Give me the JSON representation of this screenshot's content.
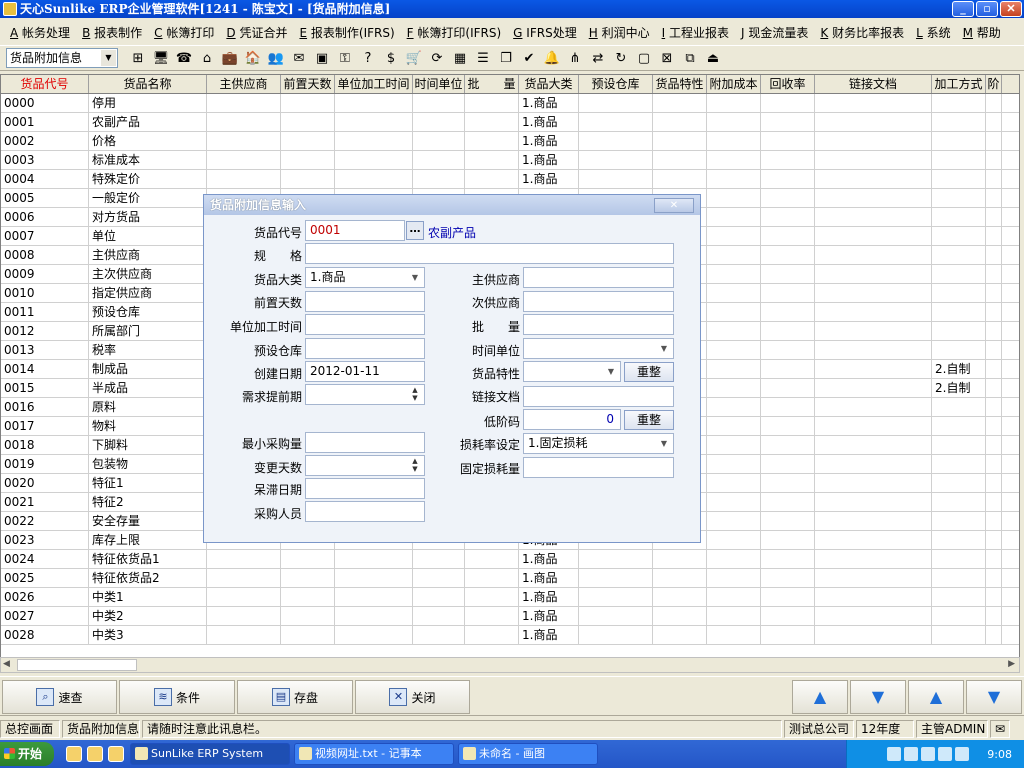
{
  "window": {
    "title": "天心Sunlike ERP企业管理软件[1241 - 陈宝文] - [货品附加信息]",
    "min_label": "_",
    "max_label": "▫",
    "close_label": "✕"
  },
  "menu": [
    {
      "key": "A",
      "label": "帐务处理"
    },
    {
      "key": "B",
      "label": "报表制作"
    },
    {
      "key": "C",
      "label": "帐簿打印"
    },
    {
      "key": "D",
      "label": "凭证合并"
    },
    {
      "key": "E",
      "label": "报表制作(IFRS)"
    },
    {
      "key": "F",
      "label": "帐簿打印(IFRS)"
    },
    {
      "key": "G",
      "label": "IFRS处理"
    },
    {
      "key": "H",
      "label": "利润中心"
    },
    {
      "key": "I",
      "label": "工程业报表"
    },
    {
      "key": "J",
      "label": "现金流量表"
    },
    {
      "key": "K",
      "label": "财务比率报表"
    },
    {
      "key": "L",
      "label": "系统"
    },
    {
      "key": "M",
      "label": "帮助"
    }
  ],
  "toolbar": {
    "combo_value": "货品附加信息"
  },
  "grid": {
    "columns": [
      "货品代号",
      "货品名称",
      "主供应商",
      "前置天数",
      "单位加工时间",
      "时间单位",
      "批　　量",
      "货品大类",
      "预设仓库",
      "货品特性",
      "附加成本",
      "回收率",
      "链接文档",
      "加工方式",
      "阶"
    ],
    "rows": [
      [
        "0000",
        "停用",
        "1.商品",
        ""
      ],
      [
        "0001",
        "农副产品",
        "1.商品",
        ""
      ],
      [
        "0002",
        "价格",
        "1.商品",
        ""
      ],
      [
        "0003",
        "标准成本",
        "1.商品",
        ""
      ],
      [
        "0004",
        "特殊定价",
        "1.商品",
        ""
      ],
      [
        "0005",
        "一般定价",
        "",
        ""
      ],
      [
        "0006",
        "对方货品",
        "",
        ""
      ],
      [
        "0007",
        "单位",
        "",
        ""
      ],
      [
        "0008",
        "主供应商",
        "",
        ""
      ],
      [
        "0009",
        "主次供应商",
        "",
        ""
      ],
      [
        "0010",
        "指定供应商",
        "",
        ""
      ],
      [
        "0011",
        "预设仓库",
        "",
        ""
      ],
      [
        "0012",
        "所属部门",
        "",
        ""
      ],
      [
        "0013",
        "税率",
        "",
        ""
      ],
      [
        "0014",
        "制成品",
        "",
        "2.自制"
      ],
      [
        "0015",
        "半成品",
        "",
        "2.自制"
      ],
      [
        "0016",
        "原料",
        "",
        ""
      ],
      [
        "0017",
        "物料",
        "",
        ""
      ],
      [
        "0018",
        "下脚料",
        "",
        ""
      ],
      [
        "0019",
        "包装物",
        "",
        ""
      ],
      [
        "0020",
        "特征1",
        "",
        ""
      ],
      [
        "0021",
        "特征2",
        "",
        ""
      ],
      [
        "0022",
        "安全存量",
        "",
        ""
      ],
      [
        "0023",
        "库存上限",
        "1.商品",
        ""
      ],
      [
        "0024",
        "特征依货品1",
        "1.商品",
        ""
      ],
      [
        "0025",
        "特征依货品2",
        "1.商品",
        ""
      ],
      [
        "0026",
        "中类1",
        "1.商品",
        ""
      ],
      [
        "0027",
        "中类2",
        "1.商品",
        ""
      ],
      [
        "0028",
        "中类3",
        "1.商品",
        ""
      ]
    ]
  },
  "bottom_buttons": {
    "query": "速查",
    "condition": "条件",
    "save": "存盘",
    "close": "关闭"
  },
  "nav": {
    "first": "▲",
    "next": "▼",
    "prev_page": "▲",
    "last": "▼"
  },
  "status": {
    "panel1": "总控画面",
    "panel2": "货品附加信息",
    "message": "请随时注意此讯息栏。",
    "company": "测试总公司",
    "year": "12年度",
    "user": "主管ADMIN"
  },
  "taskbar": {
    "start": "开始",
    "items": [
      "SunLike ERP System",
      "视频网址.txt - 记事本",
      "未命名 - 画图"
    ],
    "clock": "9:08"
  },
  "dialog": {
    "title": "货品附加信息输入",
    "close_label": "✕",
    "labels": {
      "code": "货品代号",
      "spec": "规　　格",
      "category": "货品大类",
      "lead_days": "前置天数",
      "unit_time": "单位加工时间",
      "warehouse": "预设仓库",
      "created": "创建日期",
      "demand_lead": "需求提前期",
      "min_purchase": "最小采购量",
      "change_days": "变更天数",
      "stale_date": "呆滞日期",
      "buyer": "采购人员",
      "main_supplier": "主供应商",
      "sub_supplier": "次供应商",
      "batch": "批　　量",
      "time_unit": "时间单位",
      "feature": "货品特性",
      "doc_link": "链接文档",
      "low_code": "低阶码",
      "loss_setting": "损耗率设定",
      "fixed_loss": "固定损耗量"
    },
    "values": {
      "code": "0001",
      "code_name": "农副产品",
      "category": "1.商品",
      "created": "2012-01-11",
      "low_code": "0",
      "loss_setting": "1.固定损耗"
    },
    "reset_label": "重整",
    "dots_label": "…"
  }
}
